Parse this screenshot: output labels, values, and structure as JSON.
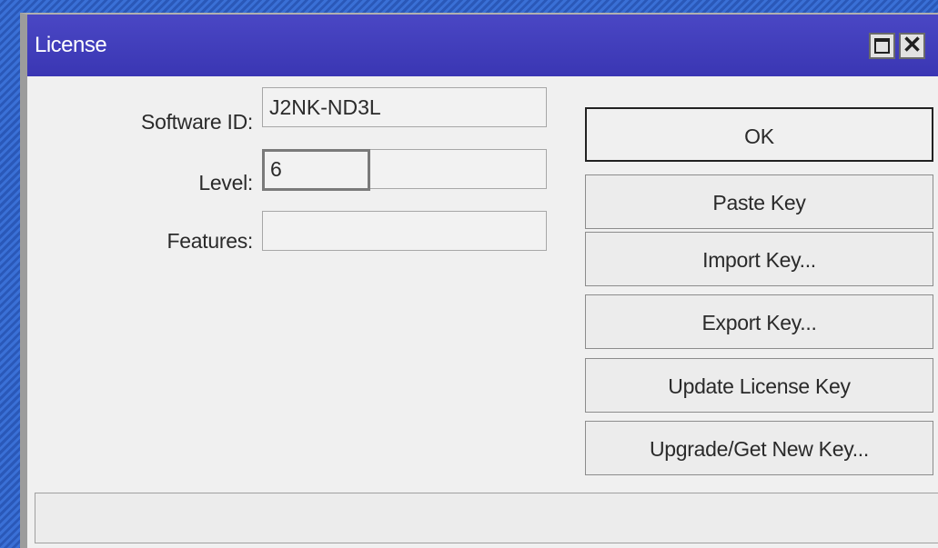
{
  "window": {
    "title": "License",
    "maximize_icon": "maximize-icon",
    "close_icon": "close-icon",
    "close_glyph": "✕"
  },
  "form": {
    "software_id": {
      "label": "Software ID:",
      "value": "J2NK-ND3L"
    },
    "level": {
      "label": "Level:",
      "value": "6"
    },
    "features": {
      "label": "Features:",
      "value": ""
    }
  },
  "buttons": {
    "ok": "OK",
    "paste_key": "Paste Key",
    "import_key": "Import Key...",
    "export_key": "Export Key...",
    "update_license_key": "Update License Key",
    "upgrade_get_new_key": "Upgrade/Get New Key..."
  },
  "statusbar": {
    "text": ""
  }
}
